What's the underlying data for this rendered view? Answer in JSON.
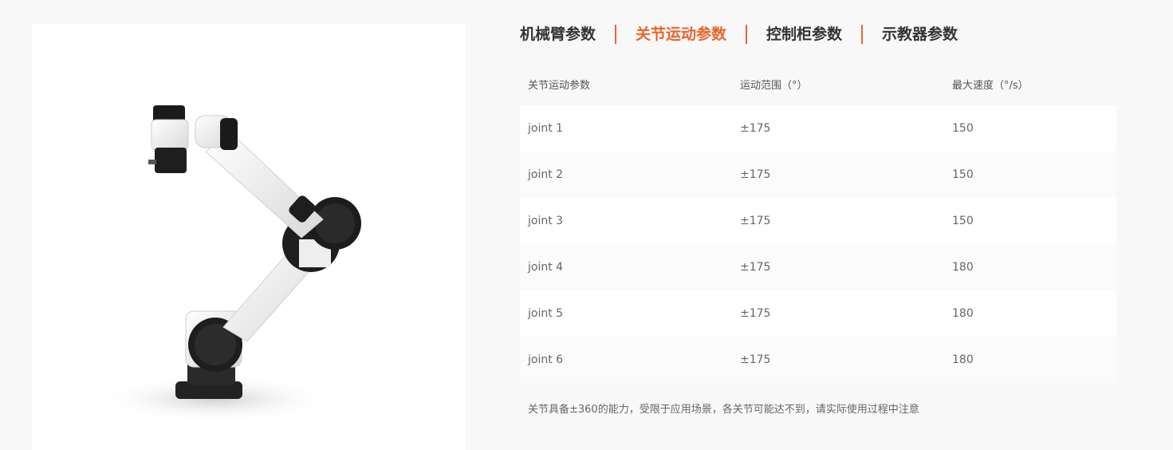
{
  "tabs": [
    {
      "label": "机械臂参数",
      "active": false
    },
    {
      "label": "关节运动参数",
      "active": true
    },
    {
      "label": "控制柜参数",
      "active": false
    },
    {
      "label": "示教器参数",
      "active": false
    }
  ],
  "table": {
    "headers": [
      "关节运动参数",
      "运动范围（°）",
      "最大速度（°/s）"
    ],
    "rows": [
      [
        "joint 1",
        "±175",
        "150"
      ],
      [
        "joint 2",
        "±175",
        "150"
      ],
      [
        "joint 3",
        "±175",
        "150"
      ],
      [
        "joint 4",
        "±175",
        "180"
      ],
      [
        "joint 5",
        "±175",
        "180"
      ],
      [
        "joint 6",
        "±175",
        "180"
      ]
    ]
  },
  "note": "关节具备±360的能力，受限于应用场景，各关节可能达不到，请实际使用过程中注意",
  "colors": {
    "accent": "#e8662a",
    "text": "#333333",
    "muted": "#666666"
  },
  "image": {
    "subject": "robot-arm-image"
  }
}
